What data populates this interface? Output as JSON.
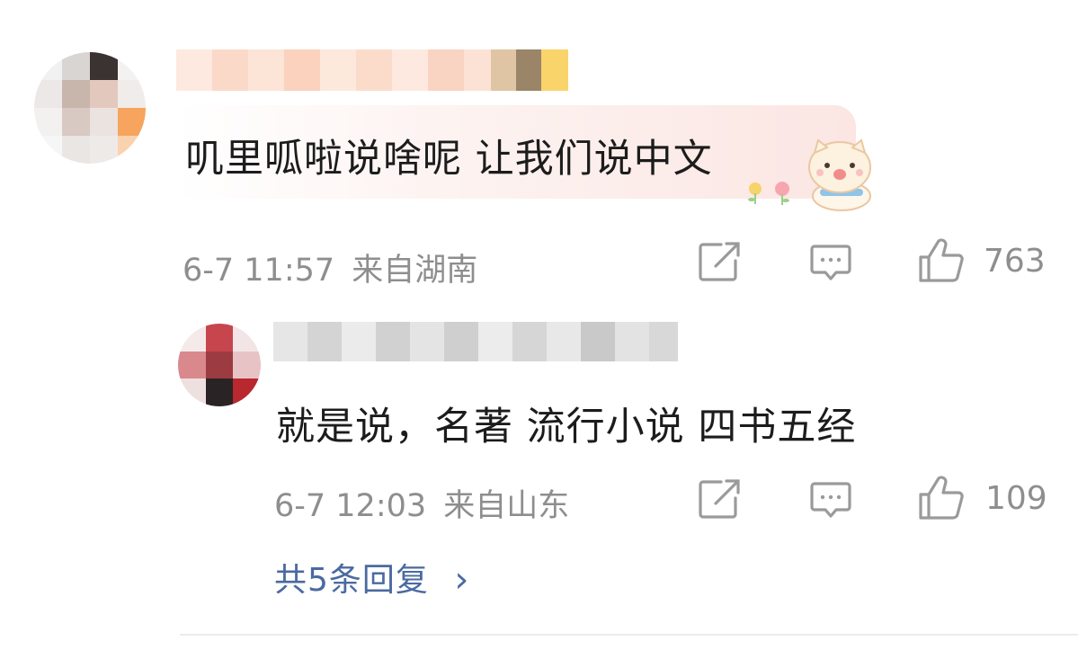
{
  "comments": [
    {
      "text": "叽里呱啦说啥呢 让我们说中文",
      "time": "6-7 11:57",
      "location": "来自湖南",
      "likes": "763"
    },
    {
      "text": "就是说，名著 流行小说 四书五经",
      "time": "6-7 12:03",
      "location": "来自山东",
      "likes": "109"
    }
  ],
  "replies_link": {
    "label": "共5条回复",
    "chevron": "›"
  },
  "icons": {
    "share": "share-icon",
    "comment": "comment-icon",
    "like": "thumbs-up-icon"
  },
  "colors": {
    "link": "#4a6aa0",
    "meta": "#8e8e8e",
    "icon": "#9a9a9a",
    "bubble": "#fbe6e3"
  }
}
